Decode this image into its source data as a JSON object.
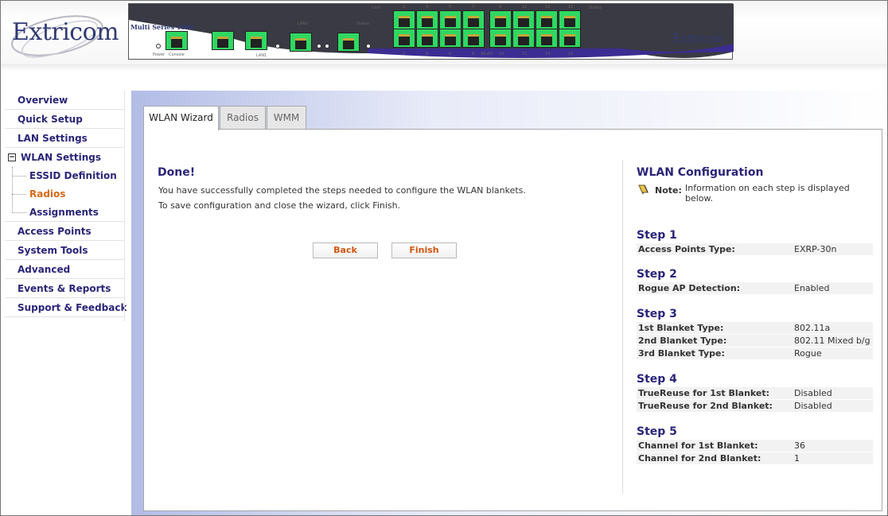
{
  "header": {
    "logo_text": "Extricom",
    "device": {
      "model": "Multi Series 1000",
      "brand": "Extricom",
      "labels": [
        "Power",
        "Console",
        "LAN1",
        "LAN2",
        "Status",
        "Link",
        "Status",
        "WLAN"
      ],
      "port_numbers_top": [
        "1",
        "3",
        "5",
        "7",
        "9",
        "11",
        "13",
        "15"
      ],
      "port_numbers_bottom": [
        "2",
        "4",
        "6",
        "8",
        "10",
        "12",
        "14",
        "16"
      ],
      "port_color": "#2fd861"
    }
  },
  "sidebar": {
    "items": [
      {
        "label": "Overview"
      },
      {
        "label": "Quick Setup"
      },
      {
        "label": "LAN Settings"
      },
      {
        "label": "WLAN Settings",
        "expanded": true,
        "children": [
          {
            "label": "ESSID Definition"
          },
          {
            "label": "Radios",
            "active": true
          },
          {
            "label": "Assignments"
          }
        ]
      },
      {
        "label": "Access Points"
      },
      {
        "label": "System Tools"
      },
      {
        "label": "Advanced"
      },
      {
        "label": "Events & Reports"
      },
      {
        "label": "Support & Feedback"
      }
    ]
  },
  "tabs": [
    {
      "label": "WLAN Wizard",
      "active": true
    },
    {
      "label": "Radios"
    },
    {
      "label": "WMM"
    }
  ],
  "wizard": {
    "title": "Done!",
    "message1": "You have successfully completed the steps needed to configure the WLAN blankets.",
    "message2": "To save configuration and close the wizard, click Finish.",
    "back_label": "Back",
    "finish_label": "Finish"
  },
  "config": {
    "title": "WLAN Configuration",
    "note_label": "Note:",
    "note_text": "Information on each step is displayed below.",
    "steps": [
      {
        "title": "Step 1",
        "rows": [
          {
            "k": "Access Points Type:",
            "v": "EXRP-30n"
          }
        ]
      },
      {
        "title": "Step 2",
        "rows": [
          {
            "k": "Rogue AP Detection:",
            "v": "Enabled"
          }
        ]
      },
      {
        "title": "Step 3",
        "rows": [
          {
            "k": "1st Blanket Type:",
            "v": "802.11a"
          },
          {
            "k": "2nd Blanket Type:",
            "v": "802.11 Mixed b/g"
          },
          {
            "k": "3rd Blanket Type:",
            "v": "Rogue"
          }
        ]
      },
      {
        "title": "Step 4",
        "rows": [
          {
            "k": "TrueReuse for 1st Blanket:",
            "v": "Disabled"
          },
          {
            "k": "TrueReuse for 2nd Blanket:",
            "v": "Disabled"
          }
        ]
      },
      {
        "title": "Step 5",
        "rows": [
          {
            "k": "Channel for 1st Blanket:",
            "v": "36"
          },
          {
            "k": "Channel for 2nd Blanket:",
            "v": "1"
          }
        ]
      }
    ]
  },
  "colors": {
    "nav_text": "#2a2578",
    "active_text": "#d86a14",
    "button_text": "#d2540e"
  }
}
